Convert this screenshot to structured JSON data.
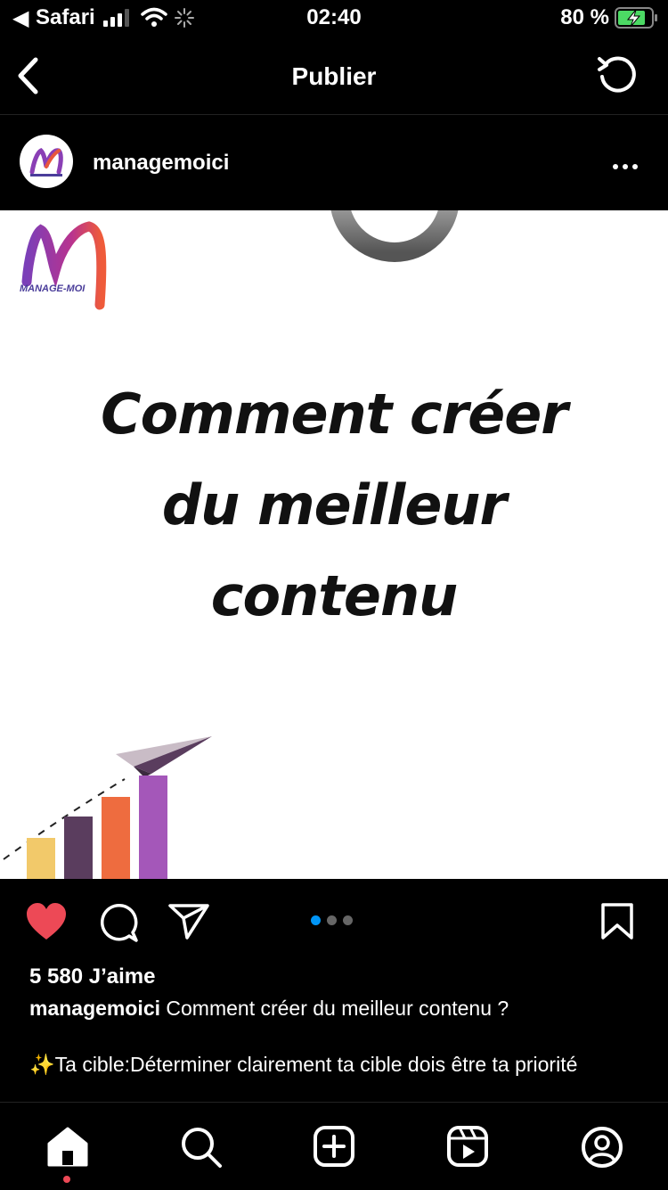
{
  "status_bar": {
    "back_arrow": "◀",
    "carrier": "Safari",
    "time": "02:40",
    "battery_percent": "80 %"
  },
  "header": {
    "title": "Publier",
    "back_icon": "chevron-left-icon",
    "refresh_icon": "refresh-icon"
  },
  "post": {
    "username": "managemoici",
    "brand_logo_text": "MANAGE-MOI",
    "headline": [
      "Comment créer",
      "du meilleur",
      "contenu"
    ],
    "carousel": {
      "current": 1,
      "total": 3
    },
    "likes": "5 580 J’aime",
    "caption_user": "managemoici",
    "caption_text": "Comment créer du meilleur contenu ?",
    "caption_tip": "✨Ta cible:Déterminer clairement ta cible dois être ta priorité"
  },
  "colors": {
    "like_red": "#ed4956",
    "carousel_active": "#0095f6",
    "bar_yellow": "#f2c96a",
    "bar_purple_dark": "#5a3d5e",
    "bar_orange": "#ee6c3f",
    "bar_purple": "#a457b9"
  }
}
